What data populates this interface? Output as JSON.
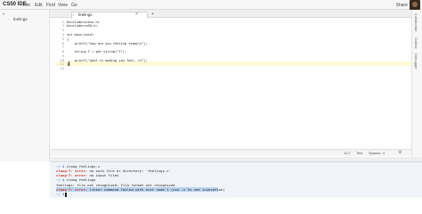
{
  "app": {
    "title": "CS50 IDE"
  },
  "menu": [
    "File",
    "Edit",
    "Find",
    "View",
    "Go"
  ],
  "header": {
    "share_label": "Share"
  },
  "sidebar": {
    "file_name": "feelings"
  },
  "editor": {
    "tab_label": "feelings",
    "tab_close": "×",
    "tab_add": "+",
    "line_numbers": [
      "1",
      "2",
      "3",
      "4",
      "5",
      "6",
      "7",
      "8",
      "9",
      "10",
      "11",
      "12"
    ],
    "lines": [
      "#include<stdio.h>",
      "#include<cs50.h>",
      "",
      "int main(void)",
      "{",
      "    printf(\"how are you feeling today\\n\");",
      "",
      "    string f = get_string(\"f\");",
      "",
      "    printf(\"what is making you feel, %f\");",
      "}",
      ""
    ]
  },
  "status": {
    "position": "11:2",
    "mode": "Text",
    "indent": "Spaces: 4"
  },
  "right_panel": [
    "Collaborate",
    "Outline",
    "Debugger"
  ],
  "terminal": {
    "lines": [
      {
        "prompt": "~/ $ ",
        "text": "clang feelings.c"
      },
      {
        "err": "clang-7: error: ",
        "text": "no such file or directory: 'feelings.c'"
      },
      {
        "err": "clang-7: error: ",
        "text": "no input files"
      },
      {
        "prompt": "~/ $ ",
        "text": "clang feelings"
      },
      {
        "text": "feelings: file not recognized: File format not recognized"
      },
      {
        "err": "clang-7: error: ",
        "text": "linker command failed with exit code 1 (use -v to see invocation)"
      },
      {
        "prompt": "~/ $ ",
        "text": ""
      }
    ]
  }
}
